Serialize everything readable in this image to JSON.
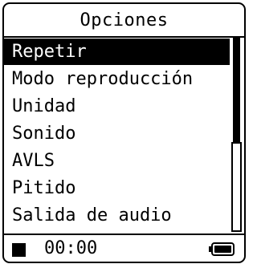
{
  "title": "Opciones",
  "menu": {
    "items": [
      {
        "label": "Repetir",
        "selected": true
      },
      {
        "label": "Modo reproducción",
        "selected": false
      },
      {
        "label": "Unidad",
        "selected": false
      },
      {
        "label": "Sonido",
        "selected": false
      },
      {
        "label": "AVLS",
        "selected": false
      },
      {
        "label": "Pitido",
        "selected": false
      },
      {
        "label": "Salida de audio",
        "selected": false
      }
    ]
  },
  "status": {
    "time": "00:00",
    "playback_icon": "stop-icon",
    "battery_icon": "battery-full-icon"
  },
  "colors": {
    "foreground": "#000000",
    "background": "#ffffff",
    "highlight": "#000000",
    "highlight_text": "#ffffff"
  }
}
